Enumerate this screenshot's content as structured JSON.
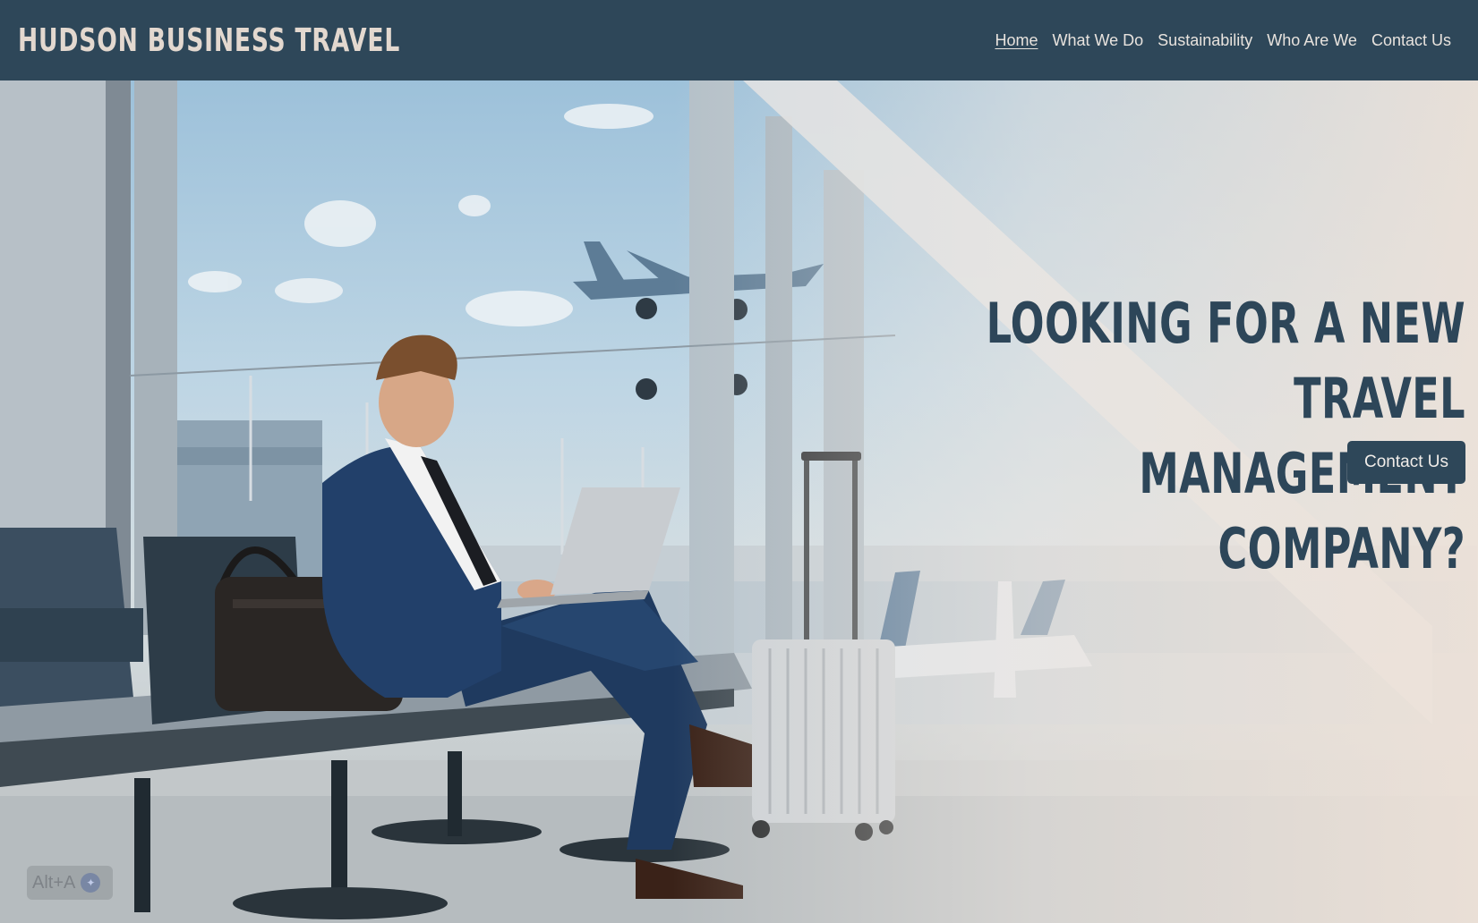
{
  "header": {
    "brand": "HUDSON BUSINESS TRAVEL",
    "nav": [
      {
        "label": "Home",
        "active": true
      },
      {
        "label": "What We Do",
        "active": false
      },
      {
        "label": "Sustainability",
        "active": false
      },
      {
        "label": "Who Are We",
        "active": false
      },
      {
        "label": "Contact Us",
        "active": false
      }
    ]
  },
  "hero": {
    "headline_line1": "LOOKING FOR A NEW TRAVEL",
    "headline_line2": "MANAGEMENT COMPANY?",
    "cta_label": "Contact Us",
    "image_subject": "businessman-with-laptop-airport-lounge"
  },
  "overlay": {
    "shortcut_label": "Alt+A",
    "icon": "assistant-icon"
  },
  "colors": {
    "header_bg": "#2e4759",
    "brand_text": "#e3d8cf",
    "headline": "#2d4659",
    "cta_bg": "#2e4759"
  }
}
